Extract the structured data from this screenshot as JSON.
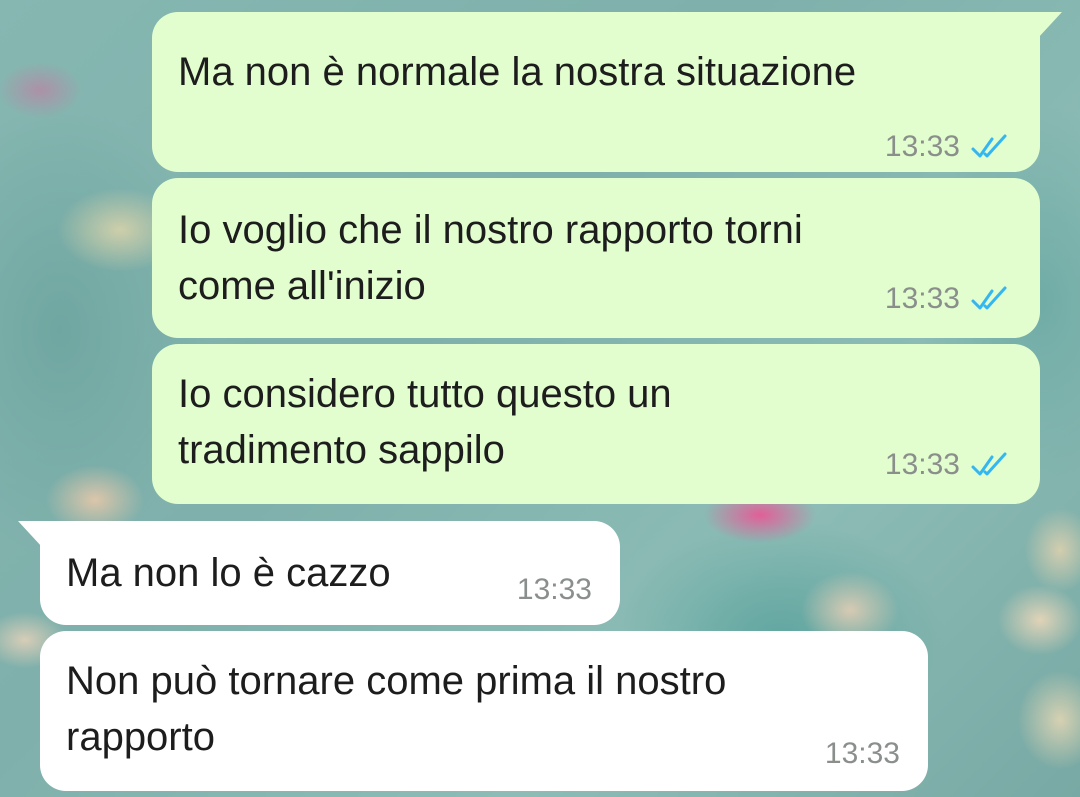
{
  "colors": {
    "outgoing_bubble": "#e2fecf",
    "incoming_bubble": "#ffffff",
    "read_ticks": "#34b7f1",
    "timestamp": "#8a8f8c",
    "text": "#1d1d1d"
  },
  "messages": [
    {
      "direction": "outgoing",
      "text": "Ma non è normale la nostra situazione",
      "time": "13:33",
      "status_icon": "double-check-read-icon"
    },
    {
      "direction": "outgoing",
      "text": "Io voglio che il nostro rapporto torni\ncome all'inizio",
      "time": "13:33",
      "status_icon": "double-check-read-icon"
    },
    {
      "direction": "outgoing",
      "text": "Io considero tutto questo un\ntradimento sappilo",
      "time": "13:33",
      "status_icon": "double-check-read-icon"
    },
    {
      "direction": "incoming",
      "text": "Ma non lo è cazzo",
      "time": "13:33"
    },
    {
      "direction": "incoming",
      "text": "Non può tornare come prima il nostro\nrapporto",
      "time": "13:33"
    }
  ]
}
